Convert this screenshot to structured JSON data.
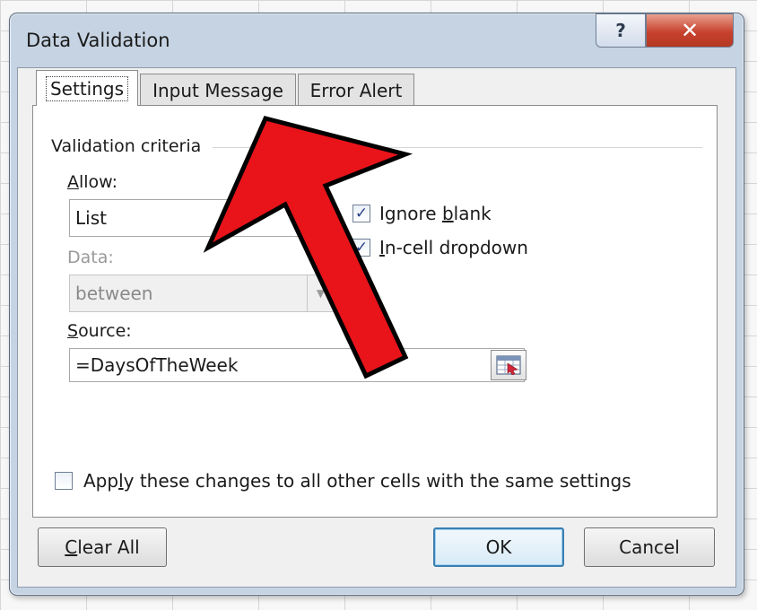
{
  "dialog": {
    "title": "Data Validation",
    "help_label": "?",
    "close_label": "✕"
  },
  "tabs": [
    {
      "label": "Settings",
      "selected": true
    },
    {
      "label": "Input Message",
      "selected": false
    },
    {
      "label": "Error Alert",
      "selected": false
    }
  ],
  "criteria": {
    "group_label": "Validation criteria",
    "allow": {
      "label_accel": "A",
      "label_rest": "llow:",
      "value": "List"
    },
    "data": {
      "label": "Data:",
      "value": "between",
      "enabled": false
    },
    "source": {
      "label_accel": "S",
      "label_rest": "ource:",
      "value": "=DaysOfTheWeek"
    }
  },
  "checkboxes": {
    "ignore_blank": {
      "label_pre": "Ignore ",
      "label_accel": "b",
      "label_post": "lank",
      "checked": true
    },
    "in_cell_dropdown": {
      "label_accel": "I",
      "label_rest": "n-cell dropdown",
      "checked": true
    }
  },
  "apply_all": {
    "label_pre": "App",
    "label_accel": "l",
    "label_post": "y these changes to all other cells with the same settings",
    "checked": false
  },
  "buttons": {
    "clear_accel": "C",
    "clear_rest": "lear All",
    "ok": "OK",
    "cancel": "Cancel"
  },
  "colors": {
    "annotation_arrow": "#e8141a",
    "close_button": "#c7422e",
    "checkmark": "#2a3f86"
  },
  "icons": {
    "checkmark": "✓",
    "dropdown": "▼",
    "range_selector": "range-selector-icon"
  }
}
